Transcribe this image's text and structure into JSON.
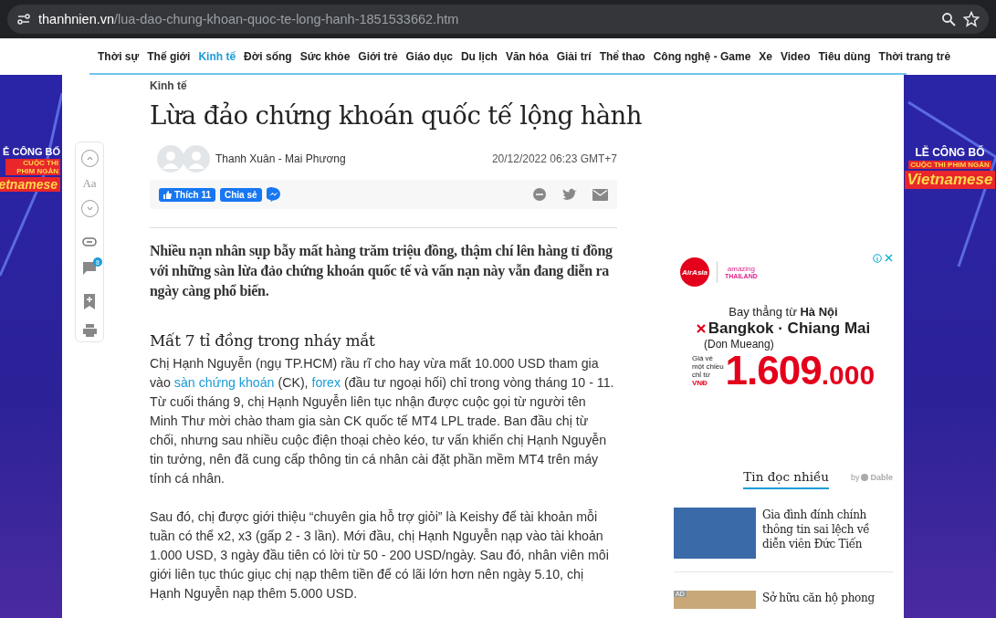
{
  "browser": {
    "url_domain": "thanhnien.vn",
    "url_path": "/lua-dao-chung-khoan-quoc-te-long-hanh-1851533662.htm"
  },
  "nav": [
    {
      "label": "Thời sự",
      "selected": false
    },
    {
      "label": "Thế giới",
      "selected": false
    },
    {
      "label": "Kinh tế",
      "selected": true
    },
    {
      "label": "Đời sống",
      "selected": false
    },
    {
      "label": "Sức khỏe",
      "selected": false
    },
    {
      "label": "Giới trẻ",
      "selected": false
    },
    {
      "label": "Giáo dục",
      "selected": false
    },
    {
      "label": "Du lịch",
      "selected": false
    },
    {
      "label": "Văn hóa",
      "selected": false
    },
    {
      "label": "Giải trí",
      "selected": false
    },
    {
      "label": "Thể thao",
      "selected": false
    },
    {
      "label": "Công nghệ - Game",
      "selected": false
    },
    {
      "label": "Xe",
      "selected": false
    },
    {
      "label": "Video",
      "selected": false
    },
    {
      "label": "Tiêu dùng",
      "selected": false
    },
    {
      "label": "Thời trang trẻ",
      "selected": false
    }
  ],
  "banners": {
    "left": {
      "line1": "Ễ CÔNG BỐ",
      "line2": "CUỘC THI PHIM NGẮN",
      "line3": "etnamese"
    },
    "right": {
      "line1": "LỄ CÔNG BỐ",
      "line2": "CUỘC THI PHIM NGẮN",
      "line3": "Vietnamese"
    }
  },
  "toolbar": {
    "font_label": "Aa",
    "comment_count": "8"
  },
  "article": {
    "category": "Kinh tế",
    "title": "Lừa đảo chứng khoán quốc tế lộng hành",
    "author": "Thanh Xuân - Mai Phương",
    "date": "20/12/2022 06:23 GMT+7",
    "like_label": "Thích 11",
    "share_label": "Chia sẻ",
    "lead": "Nhiều nạn nhân sụp bẫy mất hàng trăm triệu đồng, thậm chí lên hàng tỉ đồng với những sàn lừa đảo chứng khoán quốc tế và vấn nạn này vẫn đang diễn ra ngày càng phổ biến.",
    "heading": "Mất 7 tỉ đồng trong nháy mắt",
    "paragraphs": [
      [
        {
          "text": "Chị Hạnh Nguyễn (ngụ TP.HCM) rầu rĩ cho hay vừa mất 10.000 USD tham gia vào ",
          "link": false
        },
        {
          "text": "sàn chứng khoán",
          "link": true
        },
        {
          "text": " (CK), ",
          "link": false
        },
        {
          "text": "forex",
          "link": true
        },
        {
          "text": " (đầu tư ngoại hối) chỉ trong vòng tháng 10 - 11. Từ cuối tháng 9, chị Hạnh Nguyễn liên tục nhận được cuộc gọi từ người tên Minh Thư mời chào tham gia sàn CK quốc tế MT4 LPL trade. Ban đầu chị từ chối, nhưng sau nhiều cuộc điện thoại chèo kéo, tư vấn khiến chị Hạnh Nguyễn tin tưởng, nên đã cung cấp thông tin cá nhân cài đặt phần mềm MT4 trên máy tính cá nhân.",
          "link": false
        }
      ],
      [
        {
          "text": "Sau đó, chị được giới thiệu “chuyên gia hỗ trợ giỏi” là Keishy để tài khoản mỗi tuần có thể x2, x3 (gấp 2 - 3 lần). Mới đầu, chị Hạnh Nguyễn nạp vào tài khoản 1.000 USD, 3 ngày đầu tiên có lời từ 50 - 200 USD/ngày. Sau đó, nhân viên môi giới liên tục thúc giục chị nạp thêm tiền để có lãi lớn hơn nên ngày 5.10, chị Hạnh Nguyễn nạp thêm 5.000 USD.",
          "link": false
        }
      ]
    ]
  },
  "ad": {
    "brand": "AirAsia",
    "partner_small": "amazing",
    "partner": "THAILAND",
    "line1": "Bay thẳng từ **Hà Nội**",
    "route": "Bangkok · Chiang Mai",
    "airport": "(Don Mueang)",
    "price_note": [
      "Giá vé",
      "một chiều",
      "chỉ từ",
      "VNĐ"
    ],
    "price_main": "1.609",
    "price_tail": ".000"
  },
  "most_read": {
    "title": "Tin đọc nhiều",
    "by": "by",
    "provider": "Dable",
    "items": [
      {
        "title": "Gia đình đính chính thông tin sai lệch về diễn viên Đức Tiến",
        "ad": false
      },
      {
        "title": "Sở hữu căn hộ phong",
        "ad": true,
        "ad_label": "AD"
      }
    ]
  }
}
